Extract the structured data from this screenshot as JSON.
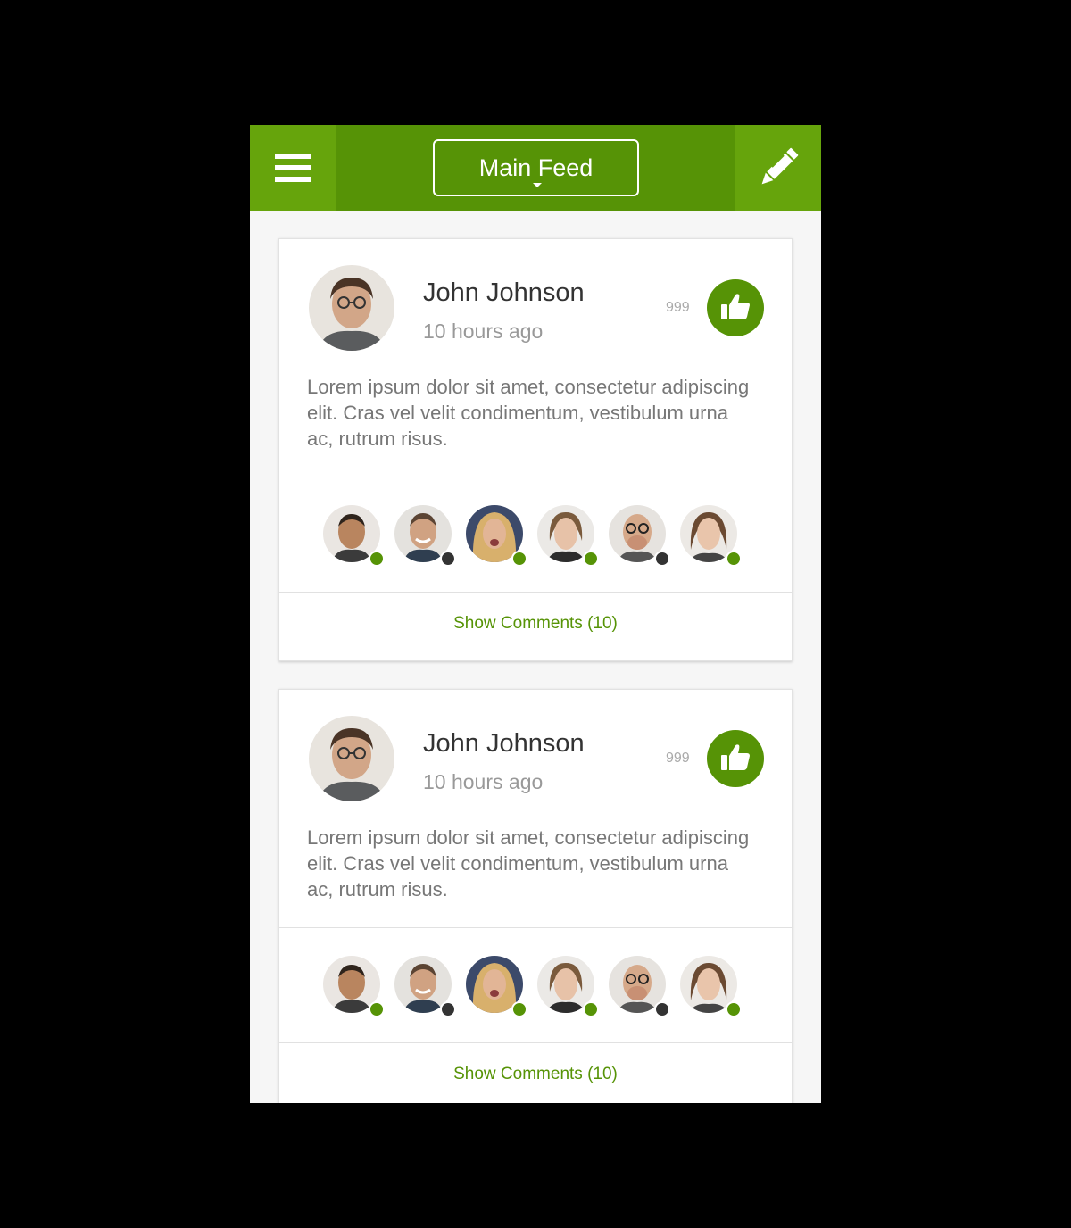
{
  "header": {
    "menu_icon": "hamburger-menu-icon",
    "feed_selector_label": "Main Feed",
    "edit_icon": "pencil-icon",
    "color_main": "#569306",
    "color_buttons": "#66a40c"
  },
  "posts": [
    {
      "author": "John Johnson",
      "time": "10 hours ago",
      "like_count": "999",
      "text": "Lorem ipsum dolor sit amet, consectetur adipiscing elit. Cras vel velit condimentum, vestibulum urna ac, rutrum risus.",
      "participants": [
        {
          "status": "online"
        },
        {
          "status": "offline"
        },
        {
          "status": "online"
        },
        {
          "status": "online"
        },
        {
          "status": "offline"
        },
        {
          "status": "online"
        }
      ],
      "comments_label": "Show Comments (10)"
    },
    {
      "author": "John Johnson",
      "time": "10 hours ago",
      "like_count": "999",
      "text": "Lorem ipsum dolor sit amet, consectetur adipiscing elit. Cras vel velit condimentum, vestibulum urna ac, rutrum risus.",
      "participants": [
        {
          "status": "online"
        },
        {
          "status": "offline"
        },
        {
          "status": "online"
        },
        {
          "status": "online"
        },
        {
          "status": "offline"
        },
        {
          "status": "online"
        }
      ],
      "comments_label": "Show Comments (10)"
    }
  ]
}
